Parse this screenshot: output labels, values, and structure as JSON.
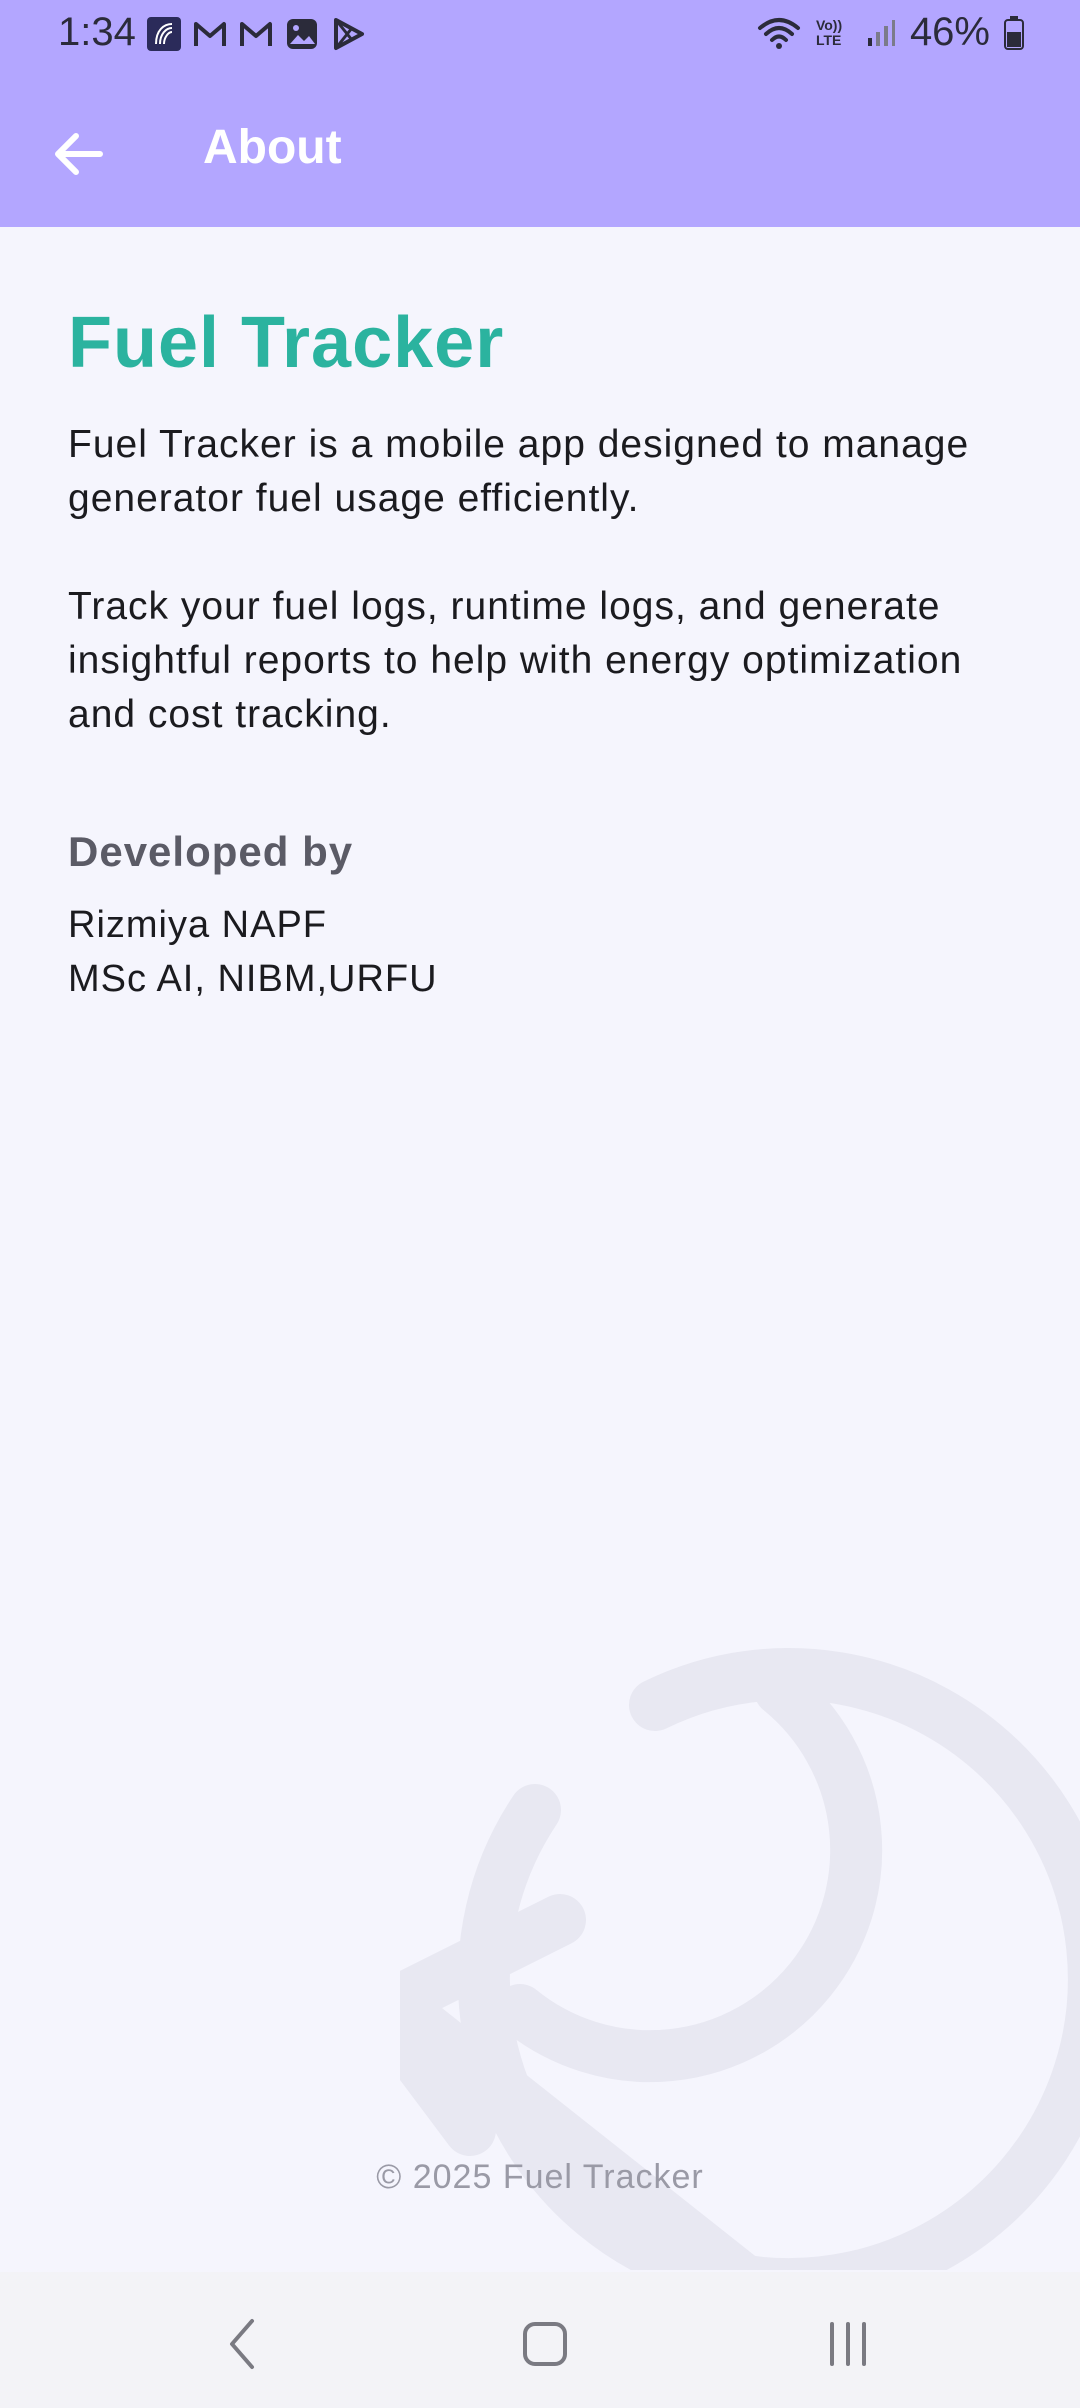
{
  "status_bar": {
    "time": "1:34",
    "notification_icons": [
      "notification-app-icon",
      "gmail-icon",
      "gmail-icon",
      "gallery-icon",
      "play-store-icon"
    ],
    "signal_label": "Vo)) LTE",
    "battery": "46%"
  },
  "app_bar": {
    "title": "About",
    "background_color": "#b3a6ff"
  },
  "content": {
    "title": "Fuel Tracker",
    "title_color": "#2bb39f",
    "description_1": "Fuel Tracker is a mobile app designed to manage generator fuel usage efficiently.",
    "description_2": "Track your fuel logs, runtime logs, and generate insightful reports to help with energy optimization and cost tracking.",
    "developed_by_heading": "Developed by",
    "developer_name": "Rizmiya NAPF",
    "developer_degree": "MSc AI, NIBM,URFU"
  },
  "footer": {
    "copyright": "© 2025 Fuel Tracker"
  },
  "nav_bar": {
    "icons": [
      "back-nav-icon",
      "home-nav-icon",
      "recents-nav-icon"
    ]
  }
}
